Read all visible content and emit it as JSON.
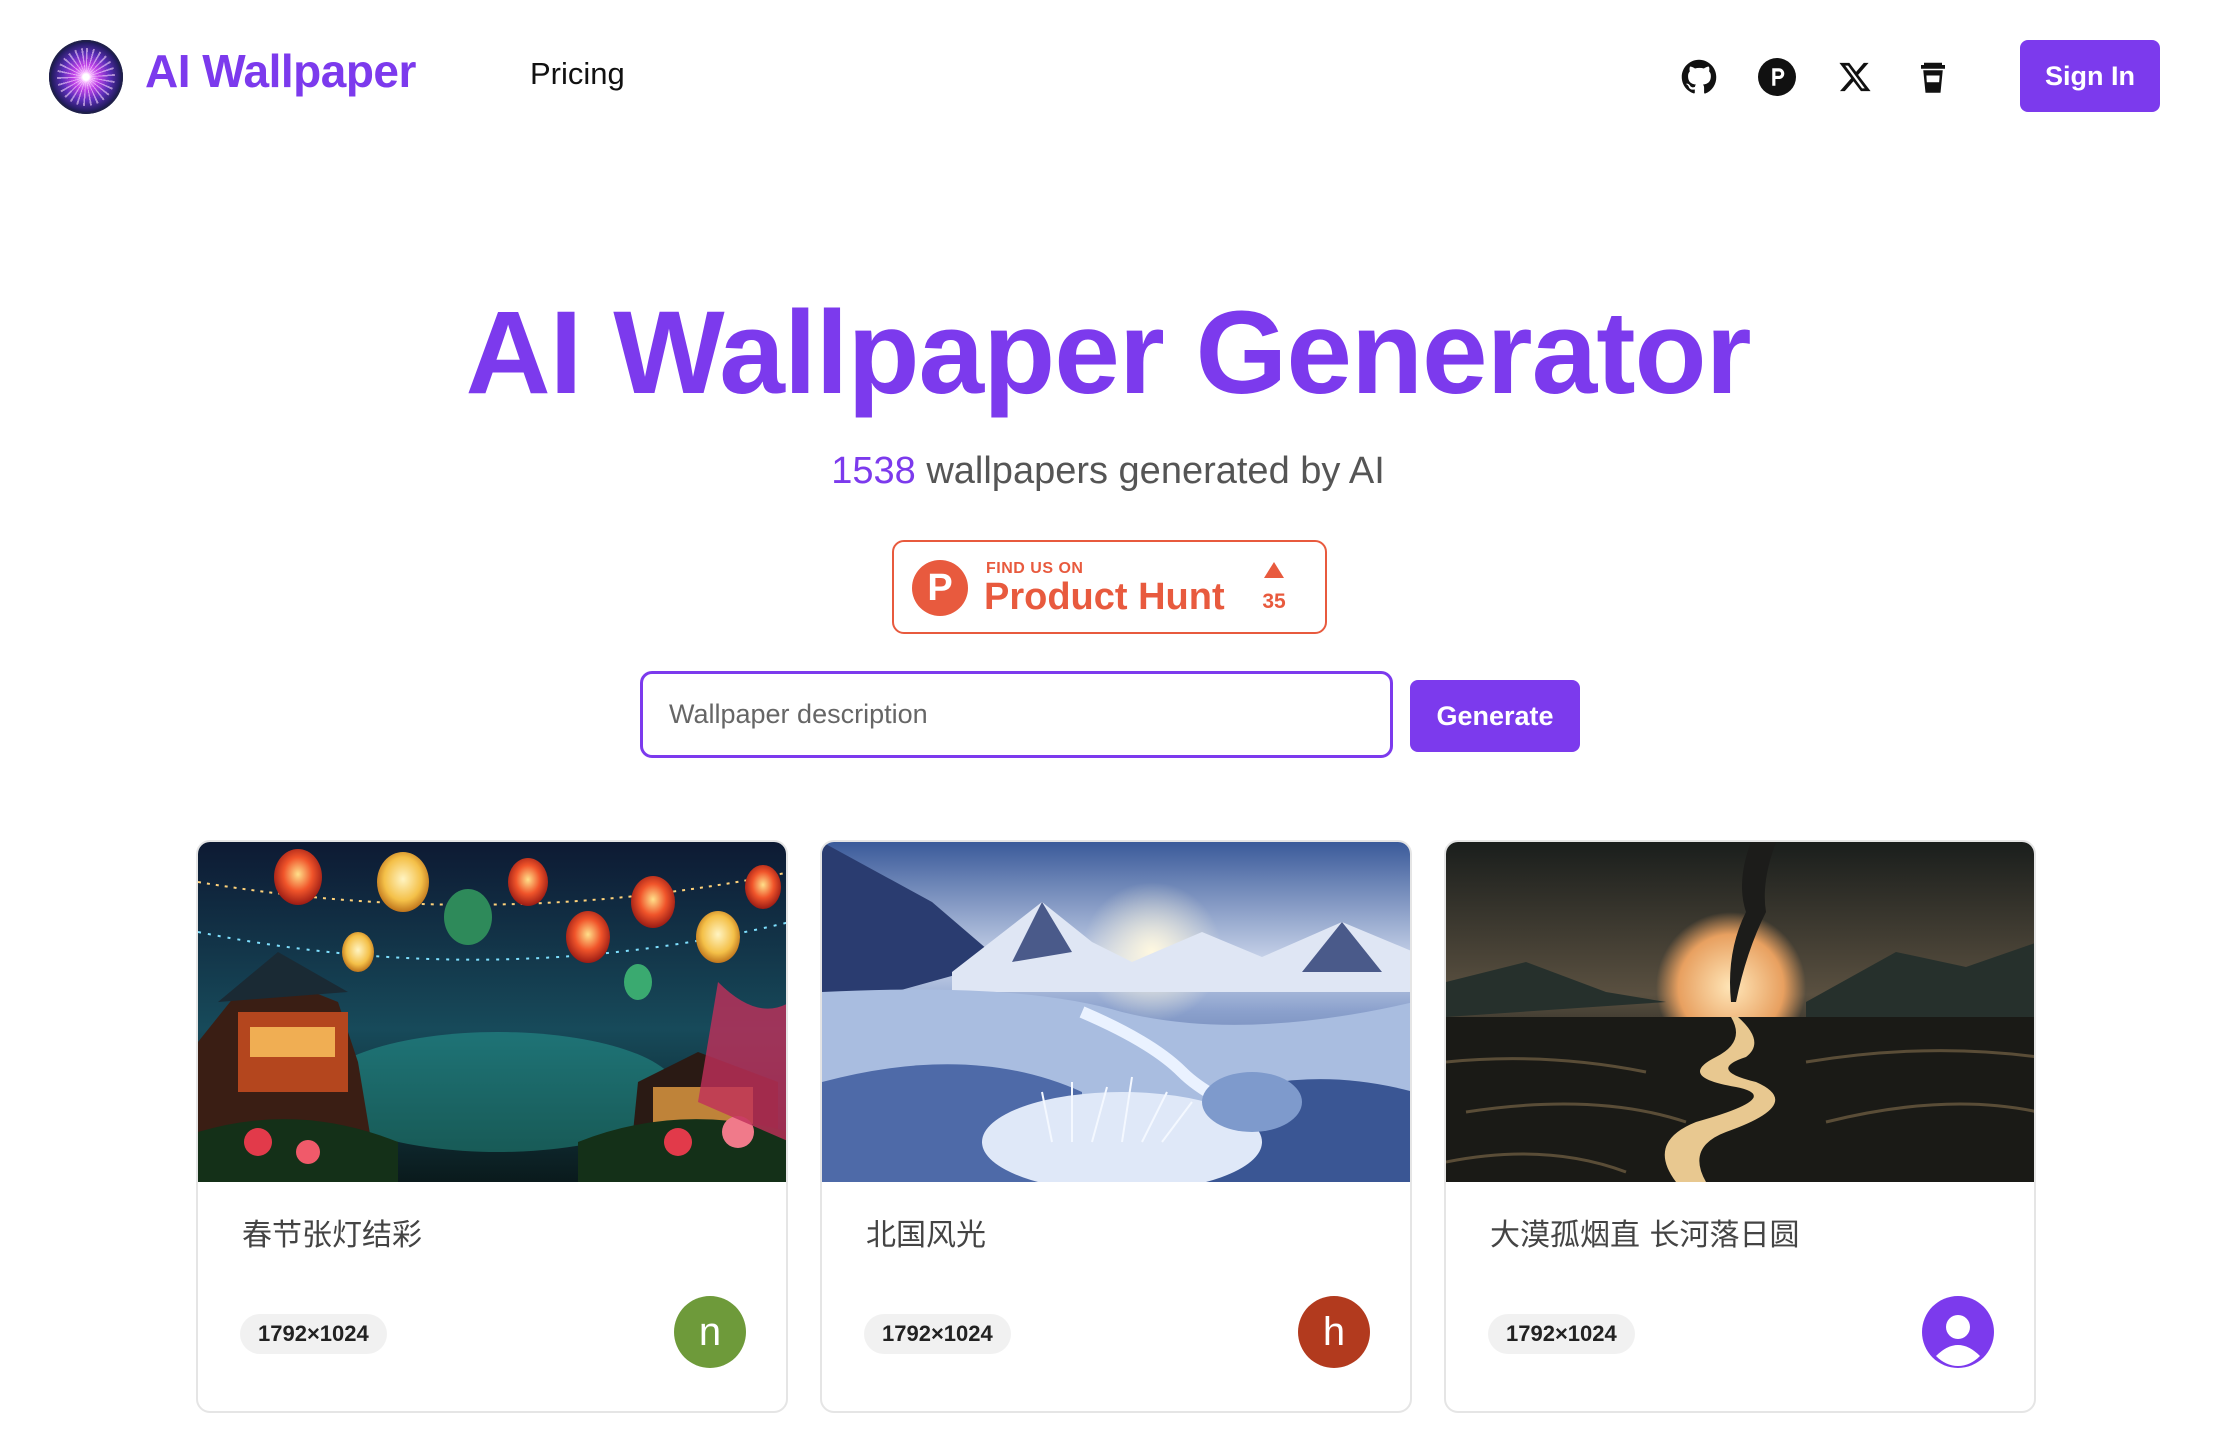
{
  "header": {
    "brand": "AI Wallpaper",
    "nav": {
      "pricing": "Pricing"
    },
    "icons": [
      "github-icon",
      "producthunt-icon",
      "x-icon",
      "coffee-cup-icon"
    ],
    "sign_in": "Sign In"
  },
  "hero": {
    "title": "AI Wallpaper Generator",
    "count": "1538",
    "subtitle_rest": "wallpapers generated by AI"
  },
  "product_hunt": {
    "find_us": "FIND US ON",
    "name": "Product Hunt",
    "logo_letter": "P",
    "votes": "35"
  },
  "search": {
    "placeholder": "Wallpaper description",
    "value": ""
  },
  "generate_label": "Generate",
  "cards": [
    {
      "title": "春节张灯结彩",
      "size": "1792×1024",
      "avatar_letter": "n",
      "avatar_color": "#6e9a3a"
    },
    {
      "title": "北国风光",
      "size": "1792×1024",
      "avatar_letter": "h",
      "avatar_color": "#b23a1e"
    },
    {
      "title": "大漠孤烟直 长河落日圆",
      "size": "1792×1024",
      "avatar_letter": "",
      "avatar_color": "#7c3aed"
    }
  ],
  "colors": {
    "accent": "#7c3aed",
    "product_hunt": "#e85a3e"
  }
}
